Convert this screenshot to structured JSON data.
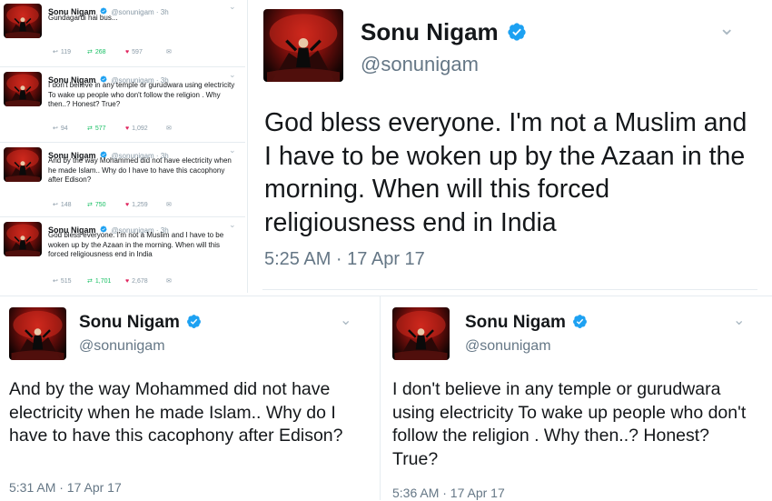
{
  "small_tweets": [
    {
      "name": "Sonu Nigam",
      "handle": "@sonunigam · 3h",
      "text": "Gundagardi hai bus...",
      "replies": "119",
      "retweets": "268",
      "likes": "597"
    },
    {
      "name": "Sonu Nigam",
      "handle": "@sonunigam · 3h",
      "text": "I don't believe in any temple or gurudwara using electricity To wake up people who don't follow the religion . Why then..? Honest? True?",
      "replies": "94",
      "retweets": "577",
      "likes": "1,092"
    },
    {
      "name": "Sonu Nigam",
      "handle": "@sonunigam · 3h",
      "text": "And by the way Mohammed did not have electricity when he made Islam.. Why do I have to have this cacophony after Edison?",
      "replies": "148",
      "retweets": "750",
      "likes": "1,259"
    },
    {
      "name": "Sonu Nigam",
      "handle": "@sonunigam · 3h",
      "text": "God bless everyone. I'm not a Muslim and I have to be woken up by the Azaan in the morning. When will this forced religiousness end in India",
      "replies": "515",
      "retweets": "1,701",
      "likes": "2,678"
    }
  ],
  "main_tweet": {
    "name": "Sonu Nigam",
    "handle": "@sonunigam",
    "text": "God bless everyone. I'm not a Muslim and I have to be woken up by the Azaan in the morning. When will this forced religiousness end in India",
    "timestamp": "5:25 AM · 17 Apr 17"
  },
  "left_tweet": {
    "name": "Sonu Nigam",
    "handle": "@sonunigam",
    "text": "And by the way Mohammed did not have electricity when he made Islam.. Why do I have to have this cacophony after Edison?",
    "timestamp": "5:31 AM · 17 Apr 17"
  },
  "right_tweet": {
    "name": "Sonu Nigam",
    "handle": "@sonunigam",
    "text": "I don't believe in any temple or gurudwara using electricity To wake up people who don't follow the religion . Why then..? Honest? True?",
    "timestamp": "5:36 AM · 17 Apr 17"
  },
  "colors": {
    "verified": "#1da1f2",
    "retweet": "#17bf63",
    "like": "#e0245e",
    "muted": "#8899a6"
  }
}
